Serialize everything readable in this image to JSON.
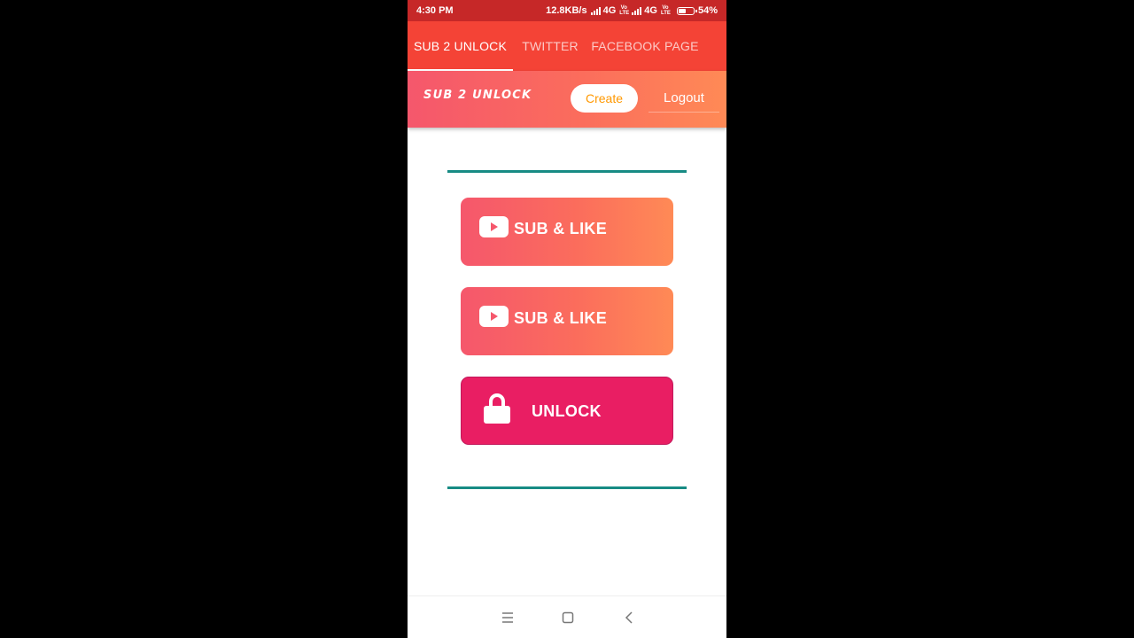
{
  "status_bar": {
    "time": "4:30 PM",
    "net_speed": "12.8KB/s",
    "network_1": "4G",
    "network_2": "4G",
    "volte_top": "Vo",
    "volte_bottom": "LTE",
    "battery": "54%",
    "battery_level": 0.54
  },
  "tabs": [
    {
      "label": "SUB 2 UNLOCK",
      "active": true
    },
    {
      "label": "TWITTER",
      "active": false
    },
    {
      "label": "FACEBOOK PAGE",
      "active": false
    }
  ],
  "header": {
    "title": "SUB 2 UNLOCK",
    "create_label": "Create",
    "logout_label": "Logout"
  },
  "buttons": {
    "sub_like_1": "SUB & LIKE",
    "sub_like_2": "SUB & LIKE",
    "unlock": "UNLOCK"
  },
  "icons": {
    "youtube": "youtube-icon",
    "lock": "lock-icon",
    "menu": "menu-icon",
    "home": "home-square-icon",
    "back": "back-chevron-icon"
  },
  "colors": {
    "status_bar": "#c62828",
    "tab_bar": "#f44336",
    "gradient_start": "#f5576c",
    "gradient_end": "#ff8a56",
    "create_text": "#ff9800",
    "divider": "#178b84",
    "unlock_button": "#e91e63",
    "nav_icon": "#777777"
  }
}
